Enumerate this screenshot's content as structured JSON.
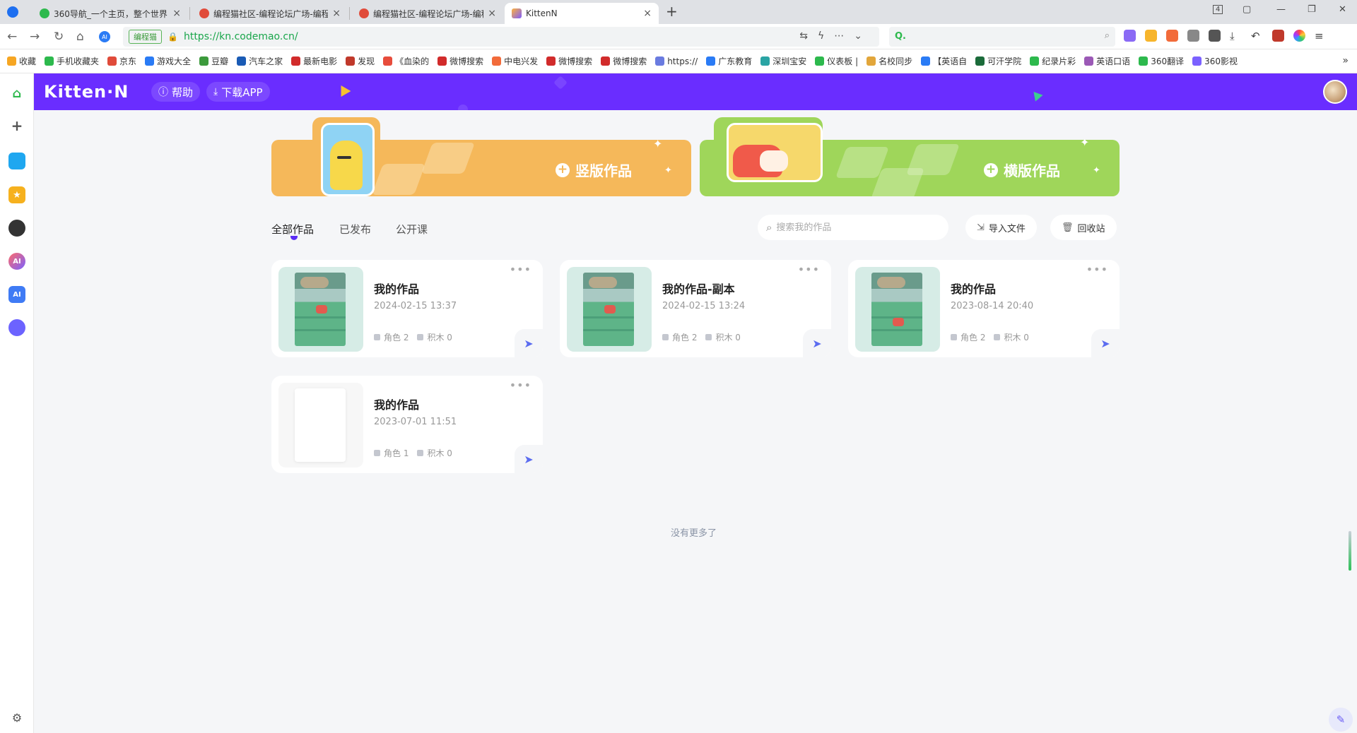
{
  "browser": {
    "tabs": [
      {
        "title": "360导航_一个主页，整个世界",
        "close": "×"
      },
      {
        "title": "编程猫社区-编程论坛广场-编程",
        "close": "×"
      },
      {
        "title": "编程猫社区-编程论坛广场-编程",
        "close": "×"
      },
      {
        "title": "KittenN",
        "close": "×"
      }
    ],
    "new_tab": "+",
    "window_badge": "4",
    "site_chip": "编程猫",
    "url": "https://kn.codemao.cn/",
    "search_hint": "Q."
  },
  "bookmarks": {
    "items": [
      "收藏",
      "手机收藏夹",
      "京东",
      "游戏大全",
      "豆瓣",
      "汽车之家",
      "最新电影",
      "发现",
      "《血染的",
      "微博搜索",
      "中电兴发",
      "微博搜索",
      "微博搜索",
      "https://",
      "广东教育",
      "深圳宝安",
      "仪表板 |",
      "名校同步",
      "【英语自",
      "可汗学院",
      "纪录片彩",
      "英语口语",
      "360翻译",
      "360影视"
    ],
    "more": "»"
  },
  "app": {
    "logo": "Kitten·N",
    "help_label": "帮助",
    "download_label": "下载APP"
  },
  "banners": {
    "vertical_label": "竖版作品",
    "horizontal_label": "横版作品"
  },
  "filters": {
    "tabs": [
      "全部作品",
      "已发布",
      "公开课"
    ],
    "search_placeholder": "搜索我的作品",
    "import_label": "导入文件",
    "recycle_label": "回收站"
  },
  "works": [
    {
      "title": "我的作品",
      "date": "2024-02-15 13:37",
      "roles": "角色 2",
      "blocks": "积木 0"
    },
    {
      "title": "我的作品-副本",
      "date": "2024-02-15 13:24",
      "roles": "角色 2",
      "blocks": "积木 0"
    },
    {
      "title": "我的作品",
      "date": "2023-08-14 20:40",
      "roles": "角色 2",
      "blocks": "积木 0"
    },
    {
      "title": "我的作品",
      "date": "2023-07-01 11:51",
      "roles": "角色 1",
      "blocks": "积木 0"
    }
  ],
  "footer": {
    "no_more": "没有更多了"
  },
  "colors": {
    "brand_purple": "#6a2dff",
    "vertical_banner": "#f5b85a",
    "horizontal_banner": "#9fd65a",
    "share_blue": "#5b6cf0"
  }
}
